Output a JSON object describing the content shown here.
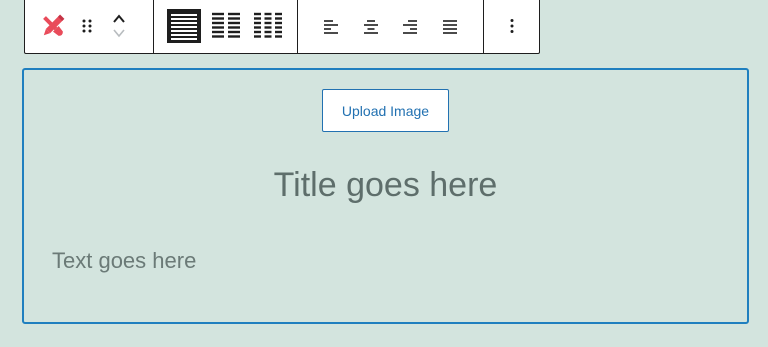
{
  "toolbar": {
    "block_icon": "brush-pencil-icon",
    "drag_icon": "drag-handle-icon",
    "move_up_icon": "chevron-up-icon",
    "move_down_icon": "chevron-down-icon",
    "layout_options": [
      "one-column-icon",
      "two-column-icon",
      "three-column-icon"
    ],
    "align_options": [
      "align-left-icon",
      "align-center-icon",
      "align-right-icon",
      "justify-icon"
    ],
    "more_icon": "more-options-icon",
    "accent_color": "#e94b5a"
  },
  "block": {
    "upload_label": "Upload Image",
    "title": "Title goes here",
    "text": "Text goes here",
    "border_color": "#1f7fbf"
  },
  "colors": {
    "background": "#d3e4de",
    "link": "#2271b1"
  }
}
